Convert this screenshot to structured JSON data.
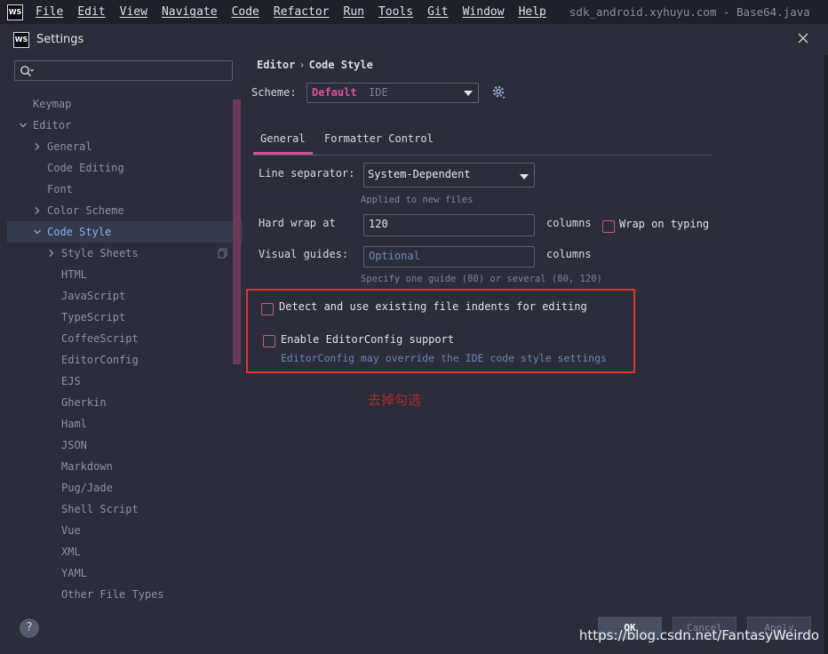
{
  "app": {
    "logo_text": "WS"
  },
  "menubar": {
    "items": [
      "File",
      "Edit",
      "View",
      "Navigate",
      "Code",
      "Refactor",
      "Run",
      "Tools",
      "Git",
      "Window",
      "Help"
    ],
    "title": "sdk_android.xyhuyu.com - Base64.java"
  },
  "dialog": {
    "title": "Settings"
  },
  "sidebar": {
    "search_placeholder": "",
    "items": [
      {
        "label": "Keymap",
        "level": 0,
        "arrow": "none"
      },
      {
        "label": "Editor",
        "level": 0,
        "arrow": "down"
      },
      {
        "label": "General",
        "level": 1,
        "arrow": "right"
      },
      {
        "label": "Code Editing",
        "level": 1,
        "arrow": "none"
      },
      {
        "label": "Font",
        "level": 1,
        "arrow": "none"
      },
      {
        "label": "Color Scheme",
        "level": 1,
        "arrow": "right"
      },
      {
        "label": "Code Style",
        "level": 1,
        "arrow": "down",
        "selected": true
      },
      {
        "label": "Style Sheets",
        "level": 2,
        "arrow": "right",
        "copy_icon": true
      },
      {
        "label": "HTML",
        "level": 2,
        "arrow": "none"
      },
      {
        "label": "JavaScript",
        "level": 2,
        "arrow": "none"
      },
      {
        "label": "TypeScript",
        "level": 2,
        "arrow": "none"
      },
      {
        "label": "CoffeeScript",
        "level": 2,
        "arrow": "none"
      },
      {
        "label": "EditorConfig",
        "level": 2,
        "arrow": "none"
      },
      {
        "label": "EJS",
        "level": 2,
        "arrow": "none"
      },
      {
        "label": "Gherkin",
        "level": 2,
        "arrow": "none"
      },
      {
        "label": "Haml",
        "level": 2,
        "arrow": "none"
      },
      {
        "label": "JSON",
        "level": 2,
        "arrow": "none"
      },
      {
        "label": "Markdown",
        "level": 2,
        "arrow": "none"
      },
      {
        "label": "Pug/Jade",
        "level": 2,
        "arrow": "none"
      },
      {
        "label": "Shell Script",
        "level": 2,
        "arrow": "none"
      },
      {
        "label": "Vue",
        "level": 2,
        "arrow": "none"
      },
      {
        "label": "XML",
        "level": 2,
        "arrow": "none"
      },
      {
        "label": "YAML",
        "level": 2,
        "arrow": "none"
      },
      {
        "label": "Other File Types",
        "level": 2,
        "arrow": "none"
      }
    ]
  },
  "main": {
    "breadcrumb": {
      "parent": "Editor",
      "separator": "›",
      "current": "Code Style"
    },
    "scheme": {
      "label": "Scheme:",
      "value": "Default",
      "suffix": "IDE"
    },
    "tabs": [
      {
        "label": "General",
        "active": true
      },
      {
        "label": "Formatter Control",
        "active": false
      }
    ],
    "line_separator": {
      "label": "Line separator:",
      "value": "System-Dependent",
      "hint": "Applied to new files"
    },
    "hard_wrap": {
      "label": "Hard wrap at",
      "value": "120",
      "unit": "columns",
      "wrap_label": "Wrap on typing",
      "wrap_checked": false
    },
    "visual_guides": {
      "label": "Visual guides:",
      "placeholder": "Optional",
      "unit": "columns",
      "hint": "Specify one guide (80) or several (80, 120)"
    },
    "detect_indents": {
      "label": "Detect and use existing file indents for editing",
      "checked": false
    },
    "editorconfig": {
      "label": "Enable EditorConfig support",
      "checked": false,
      "hint": "EditorConfig may override the IDE code style settings"
    },
    "annotation": "去掉勾选"
  },
  "footer": {
    "help": "?",
    "ok": "OK",
    "cancel": "Cancel",
    "apply": "Apply",
    "watermark": "https://blog.csdn.net/FantasyWeirdo"
  },
  "colors": {
    "accent_pink": "#d4509a",
    "selection_blue": "#82b0f3",
    "highlight_red": "#e5312f",
    "background": "#2b2d3a"
  }
}
